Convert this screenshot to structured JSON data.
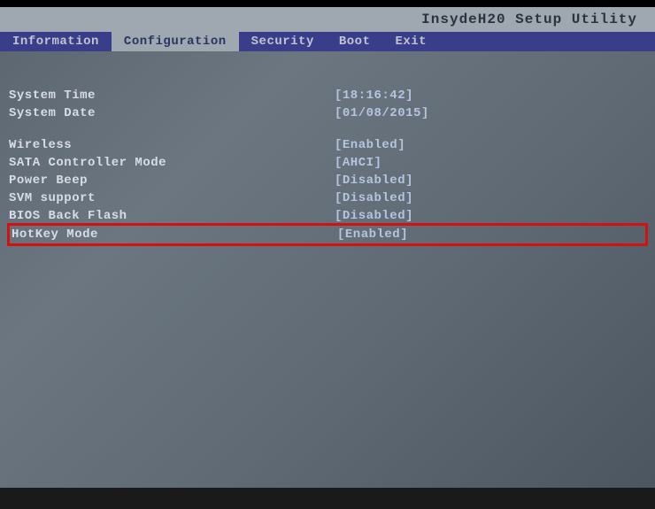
{
  "title": "InsydeH20 Setup Utility",
  "tabs": {
    "information": "Information",
    "configuration": "Configuration",
    "security": "Security",
    "boot": "Boot",
    "exit": "Exit"
  },
  "rows": {
    "system_time": {
      "label": "System Time",
      "value": "[18:16:42]"
    },
    "system_date": {
      "label": "System Date",
      "value": "[01/08/2015]"
    },
    "wireless": {
      "label": "Wireless",
      "value": "[Enabled]"
    },
    "sata_controller": {
      "label": "SATA Controller Mode",
      "value": "[AHCI]"
    },
    "power_beep": {
      "label": "Power Beep",
      "value": "[Disabled]"
    },
    "svm_support": {
      "label": "SVM support",
      "value": "[Disabled]"
    },
    "bios_back_flash": {
      "label": "BIOS Back Flash",
      "value": "[Disabled]"
    },
    "hotkey_mode": {
      "label": "HotKey Mode",
      "value": "[Enabled]"
    }
  }
}
